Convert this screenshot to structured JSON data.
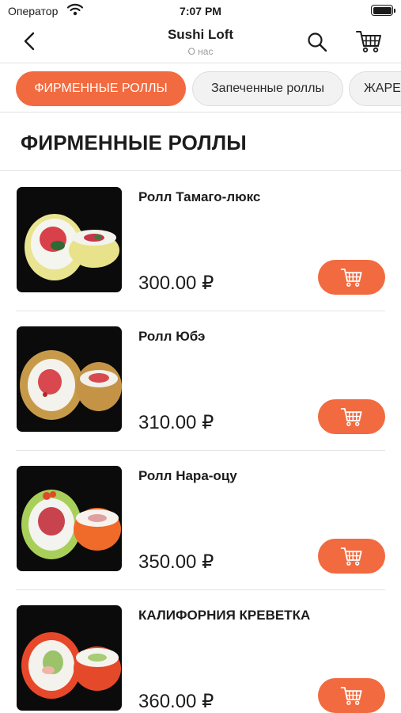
{
  "status_bar": {
    "carrier": "Оператор",
    "time": "7:07 PM"
  },
  "nav": {
    "title": "Sushi Loft",
    "subtitle": "О нас"
  },
  "categories": [
    {
      "label": "ФИРМЕННЫЕ РОЛЛЫ",
      "active": true
    },
    {
      "label": "Запеченные роллы",
      "active": false
    },
    {
      "label": "ЖАРЕ",
      "active": false
    }
  ],
  "section": {
    "title": "ФИРМЕННЫЕ РОЛЛЫ"
  },
  "products": [
    {
      "name": "Ролл Тамаго-люкс",
      "price": "300.00 ₽"
    },
    {
      "name": "Ролл Юбэ",
      "price": "310.00 ₽"
    },
    {
      "name": "Ролл Нара-оцу",
      "price": "350.00 ₽"
    },
    {
      "name": "КАЛИФОРНИЯ КРЕВЕТКА",
      "price": "360.00 ₽"
    }
  ],
  "colors": {
    "accent": "#f26a3f",
    "chip_inactive": "#f2f2f2",
    "text": "#1c1c1e",
    "muted": "#9a9a9a"
  }
}
